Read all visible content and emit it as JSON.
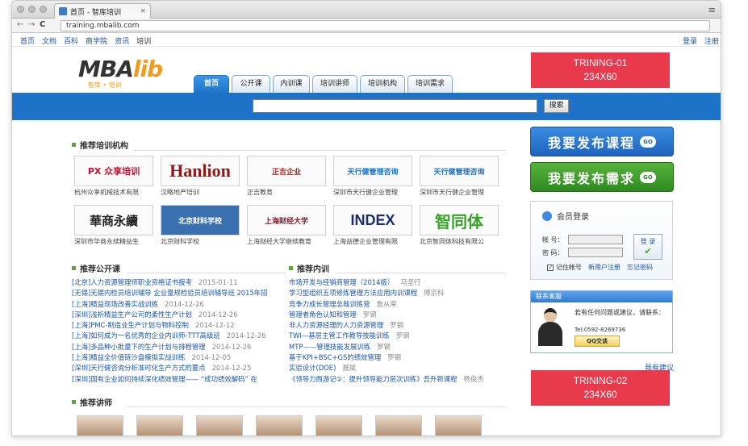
{
  "browser": {
    "tab_title": "首页 - 智库培训",
    "tab_close": "×",
    "url": "training.mbalib.com",
    "menu_glyph": "≡",
    "back": "←",
    "forward": "→",
    "reload": "C"
  },
  "topbar": {
    "links": [
      "首页",
      "文档",
      "百科",
      "商学院",
      "资讯",
      "培训"
    ],
    "right": [
      "登录",
      "注册"
    ]
  },
  "logo": {
    "main": "MBA",
    "accent": "lib",
    "sub": "智库 • 培训"
  },
  "ads": {
    "top": {
      "line1": "TRINING-01",
      "line2": "234X60"
    },
    "bottom": {
      "line1": "TRINING-02",
      "line2": "234X60"
    }
  },
  "nav": {
    "tabs": [
      "首页",
      "公开课",
      "内训课",
      "培训讲师",
      "培训机构",
      "培训需求"
    ]
  },
  "search": {
    "button": "搜索",
    "placeholder": ""
  },
  "orgs_section": {
    "title": "推荐培训机构",
    "items": [
      {
        "logo": "PX 众享培训",
        "caption": "杭州众享机械技术有限"
      },
      {
        "logo": "Hanlion",
        "caption": "汉略地产培训"
      },
      {
        "logo": "正吉企业",
        "caption": "正吉教育"
      },
      {
        "logo": "天行健管理咨询",
        "caption": "深圳市天行健企业管理"
      },
      {
        "logo": "天行健管理咨询",
        "caption": "深圳市天行健企业管理"
      },
      {
        "logo": "華商永續",
        "caption": "深圳市华商永续精益生"
      },
      {
        "logo": "北京财科学校",
        "caption": "北京财科学校"
      },
      {
        "logo": "上海财经大学",
        "caption": "上海财经大学继续教育"
      },
      {
        "logo": "INDEX",
        "caption": "上海益德企业管理有限"
      },
      {
        "logo": "智同体",
        "caption": "北京智同体科技有限公"
      }
    ]
  },
  "public_courses": {
    "title": "推荐公开课",
    "items": [
      {
        "title": "[北京]人力资源管理师职业资格证书报考",
        "date": "2015-01-11"
      },
      {
        "title": "[无锡]无锡内检员培训辅导 企业量规检验员培训辅导班 2015年招",
        "date": ""
      },
      {
        "title": "[上海]精益现场改善实战训练",
        "date": "2014-12-26"
      },
      {
        "title": "[深圳]浅析精益生产公司的柔性生产计划",
        "date": "2014-12-26"
      },
      {
        "title": "[上海]PMC-制造业生产计划与物料控制",
        "date": "2014-12-12"
      },
      {
        "title": "[上海]如何成为一名优秀的企业内训师-TTT高级班",
        "date": "2014-12-26"
      },
      {
        "title": "[上海]多品种小批量下的生产计划与排程管理",
        "date": "2014-12-26"
      },
      {
        "title": "[上海]精益全价值链沙盘模拟实战训练",
        "date": "2014-12-05"
      },
      {
        "title": "[深圳]天行健咨询分析准时化生产方式的要点",
        "date": "2014-12-25"
      },
      {
        "title": "[深圳]国有企业如何持续深化绩效管理—— “成功绩效解码” 在",
        "date": ""
      }
    ]
  },
  "internal_courses": {
    "title": "推荐内训",
    "items": [
      {
        "title": "市场开发与经销商管理（2014版）",
        "author": "马坚行"
      },
      {
        "title": "学习型组织五项修炼管理方法应用内训课程",
        "author": "傅宗科"
      },
      {
        "title": "竞争力成长管理总裁训练营",
        "author": "詹从荣"
      },
      {
        "title": "管理者角色认知和管理",
        "author": "罗钢"
      },
      {
        "title": "非人力资源经理的人力资源管理",
        "author": "罗钢"
      },
      {
        "title": "TWI—基层主管工作教导技能训练",
        "author": "罗钢"
      },
      {
        "title": "MTP——管理技能发展训练",
        "author": "罗钢"
      },
      {
        "title": "基于KPI+BSC+GS的绩效管理",
        "author": "罗钢"
      },
      {
        "title": "实验设计(DOE)",
        "author": "聂斌"
      },
      {
        "title": "《领导力西游记②：提升领导能力层次训练》吾升新课程",
        "author": "杨俊杰"
      }
    ]
  },
  "trainers_section": {
    "title": "推荐讲师",
    "count": 7
  },
  "right": {
    "publish_course": "我要发布课程",
    "publish_need": "我要发布需求",
    "go": "GO",
    "login": {
      "title": "会员登录",
      "account_label": "帐 号：",
      "password_label": "密 码：",
      "button": "登 录",
      "ok_glyph": "✔",
      "remember": "记住帐号",
      "check_glyph": "✓",
      "register": "新用户注册",
      "forgot": "忘记密码"
    },
    "service": {
      "title": "联系客服",
      "text": "若有任何问题或建议，请联系：",
      "tel": "Tel:0592-8269736",
      "qq": "QQ交谈"
    },
    "suggest": "我有建议"
  }
}
